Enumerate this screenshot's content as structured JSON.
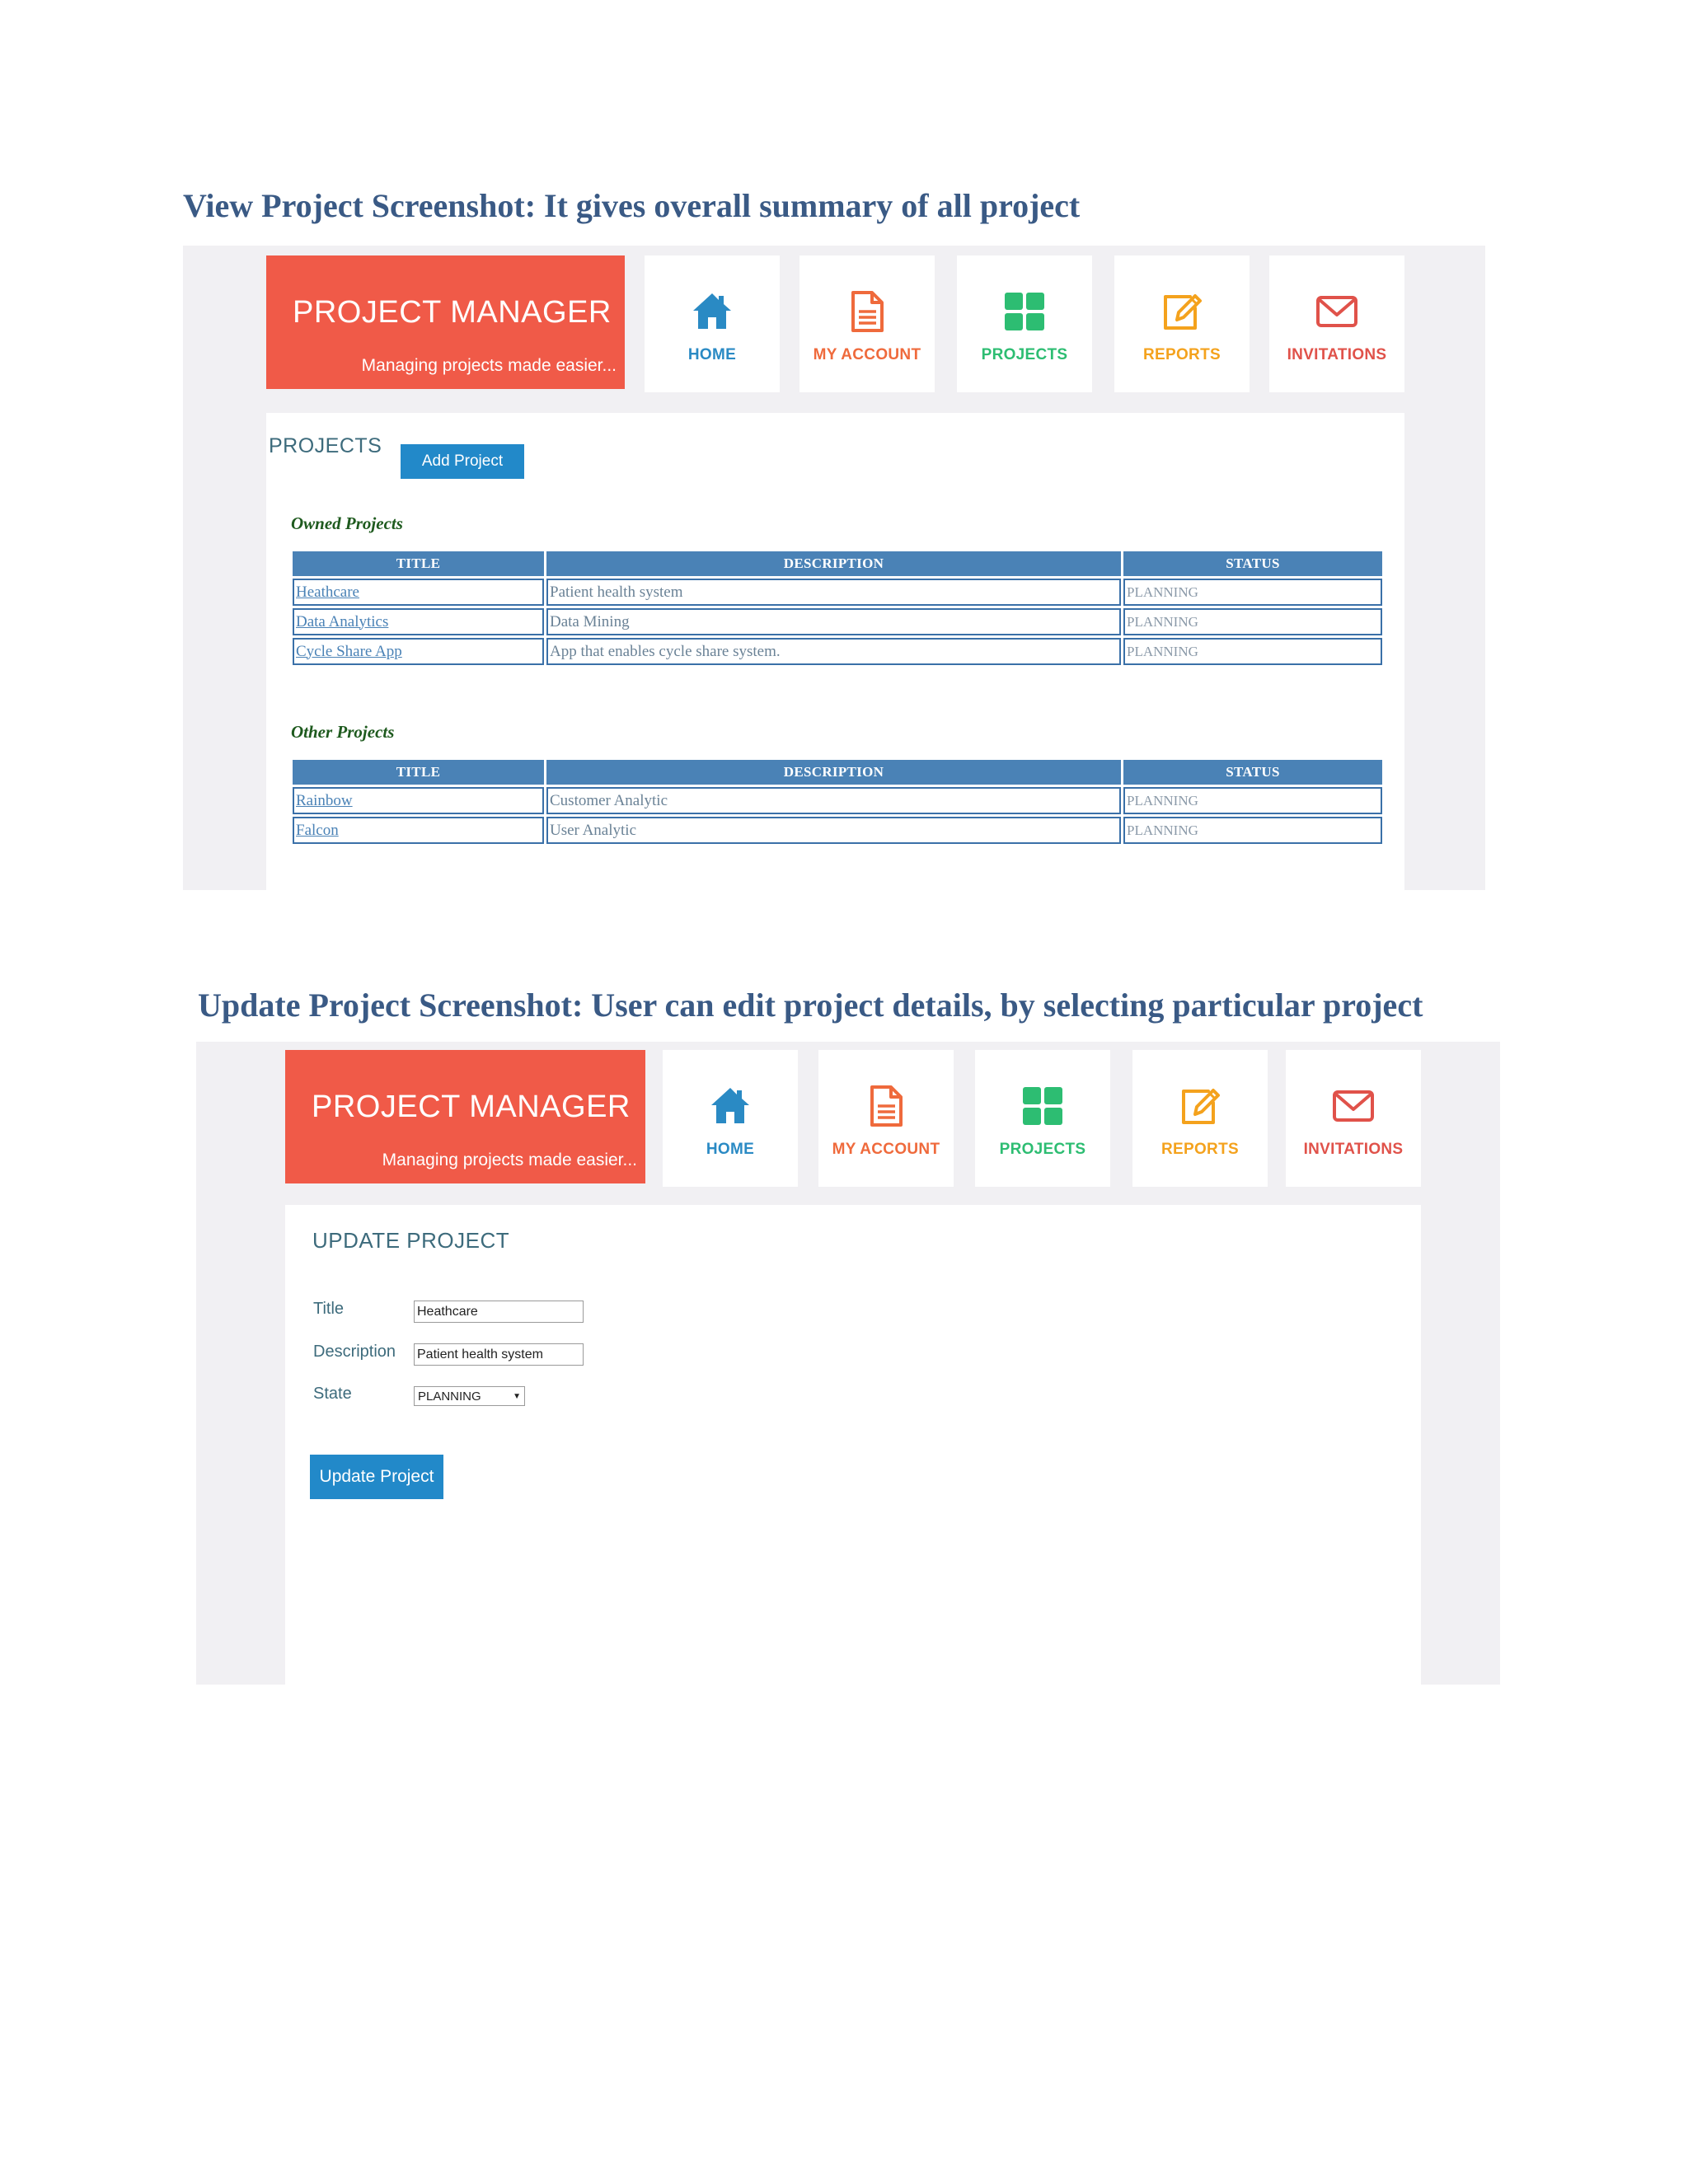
{
  "view_heading": "View Project Screenshot: It gives overall summary of all project",
  "update_heading": "Update Project Screenshot: User can edit project details, by selecting particular project",
  "app": {
    "title": "PROJECT MANAGER",
    "tagline": "Managing projects made easier...",
    "nav": [
      {
        "label": "HOME",
        "icon": "home-icon",
        "color": "#2a8ac4"
      },
      {
        "label": "MY ACCOUNT",
        "icon": "document-icon",
        "color": "#ef6a3c"
      },
      {
        "label": "PROJECTS",
        "icon": "grid-icon",
        "color": "#2dbd72"
      },
      {
        "label": "REPORTS",
        "icon": "edit-icon",
        "color": "#f4a21d"
      },
      {
        "label": "INVITATIONS",
        "icon": "mail-icon",
        "color": "#e0524a"
      }
    ]
  },
  "view": {
    "section_title": "PROJECTS",
    "add_button": "Add Project",
    "owned_heading": "Owned Projects",
    "other_heading": "Other Projects",
    "columns": [
      "TITLE",
      "DESCRIPTION",
      "STATUS"
    ],
    "owned": [
      {
        "title": "Heathcare",
        "description": "Patient health system",
        "status": "PLANNING"
      },
      {
        "title": "Data Analytics",
        "description": "Data Mining",
        "status": "PLANNING"
      },
      {
        "title": "Cycle Share App",
        "description": "App that enables cycle share system.",
        "status": "PLANNING"
      }
    ],
    "other": [
      {
        "title": "Rainbow",
        "description": "Customer Analytic",
        "status": "PLANNING"
      },
      {
        "title": "Falcon",
        "description": "User Analytic",
        "status": "PLANNING"
      }
    ]
  },
  "update": {
    "section_title": "UPDATE PROJECT",
    "title_label": "Title",
    "title_value": "Heathcare",
    "description_label": "Description",
    "description_value": "Patient health system",
    "state_label": "State",
    "state_value": "PLANNING",
    "submit": "Update Project"
  }
}
